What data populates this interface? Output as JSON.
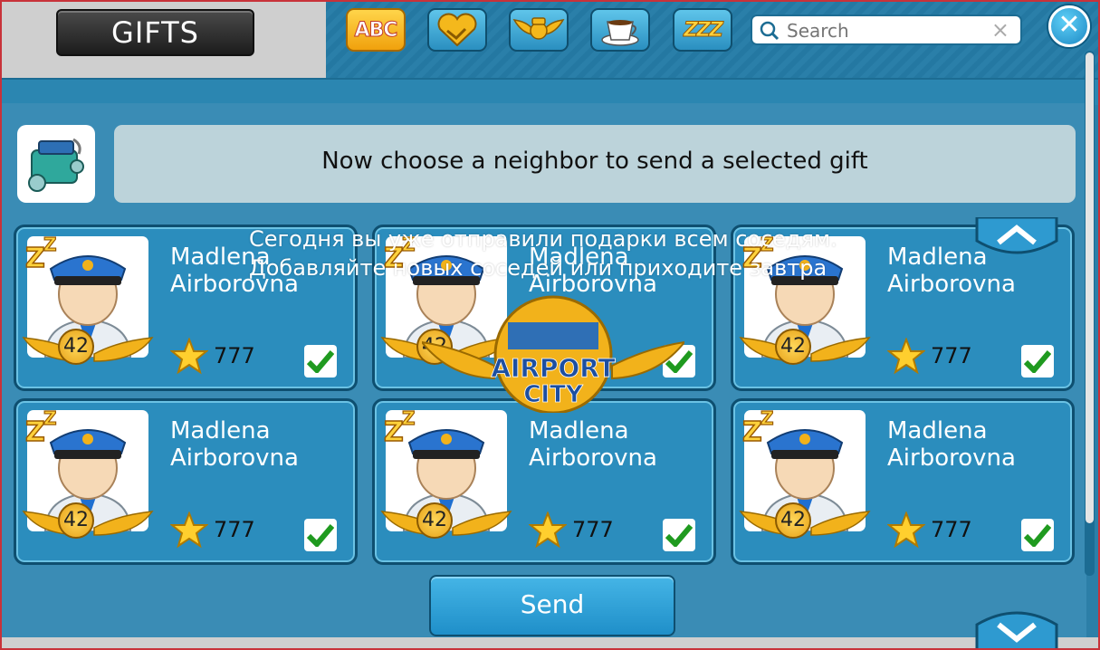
{
  "header": {
    "title": "GIFTS",
    "filters": [
      {
        "name": "abc-sort",
        "label": "ABC",
        "icon": "abc-icon",
        "active": true
      },
      {
        "name": "friendship",
        "icon": "handshake-icon",
        "active": false
      },
      {
        "name": "pilot-wings",
        "icon": "pilot-wings-icon",
        "active": false
      },
      {
        "name": "coffee",
        "icon": "coffee-cup-icon",
        "active": false
      },
      {
        "name": "sleeping",
        "label": "ZZZ",
        "icon": "sleeping-zzz-icon",
        "active": false
      }
    ],
    "search": {
      "placeholder": "Search",
      "value": ""
    },
    "close_label": "✕"
  },
  "instruction": "Now choose a neighbor to send a selected gift",
  "selected_gift_icon": "engine-part-icon",
  "notice_lines": [
    "Сегодня вы уже отправили подарки всем соседям.",
    "Добавляйте новых соседей или приходите завтра"
  ],
  "logo": {
    "line1": "AIRPORT",
    "line2": "CITY"
  },
  "neighbors": [
    {
      "first": "Madlena",
      "last": "Airborovna",
      "level": "42",
      "stars": "777",
      "selected": true
    },
    {
      "first": "Madlena",
      "last": "Airborovna",
      "level": "42",
      "stars": "777",
      "selected": true
    },
    {
      "first": "Madlena",
      "last": "Airborovna",
      "level": "42",
      "stars": "777",
      "selected": true
    },
    {
      "first": "Madlena",
      "last": "Airborovna",
      "level": "42",
      "stars": "777",
      "selected": true
    },
    {
      "first": "Madlena",
      "last": "Airborovna",
      "level": "42",
      "stars": "777",
      "selected": true
    },
    {
      "first": "Madlena",
      "last": "Airborovna",
      "level": "42",
      "stars": "777",
      "selected": true
    }
  ],
  "send_label": "Send",
  "colors": {
    "accent": "#2b8dbd",
    "frame": "#c8323a",
    "check": "#1f9a1f",
    "gold": "#f2b21b"
  }
}
